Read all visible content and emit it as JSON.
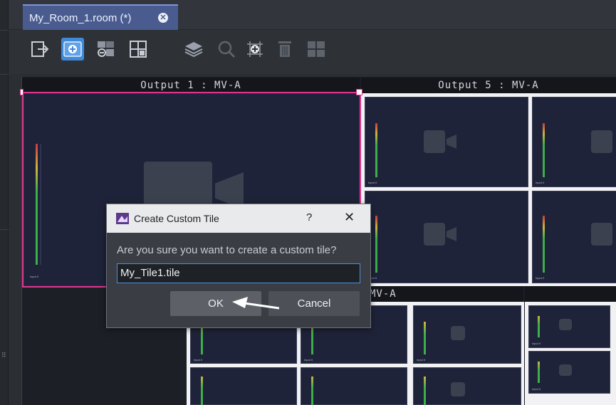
{
  "tab": {
    "title": "My_Room_1.room (*)",
    "close_icon": "close-circle-icon"
  },
  "toolbar": {
    "buttons": [
      {
        "name": "exit-icon",
        "state": "normal"
      },
      {
        "name": "add-tile-icon",
        "state": "active"
      },
      {
        "name": "link-icon",
        "state": "normal"
      },
      {
        "name": "grid-icon",
        "state": "normal"
      },
      {
        "name": "layers-icon",
        "state": "normal"
      },
      {
        "name": "zoom-icon",
        "state": "disabled"
      },
      {
        "name": "custom-tile-icon",
        "state": "normal"
      },
      {
        "name": "trash-icon",
        "state": "disabled"
      },
      {
        "name": "layout-icon",
        "state": "disabled"
      }
    ]
  },
  "outputs": {
    "output1": "Output 1 : MV-A",
    "output5": "Output 5 : MV-A",
    "output_partial": "MV-A"
  },
  "tile_label": "Input 0",
  "dialog": {
    "title": "Create Custom Tile",
    "help": "?",
    "close": "✕",
    "question": "Are you sure you want to create a custom tile?",
    "input_value": "My_Tile1.tile",
    "ok_label": "OK",
    "cancel_label": "Cancel"
  },
  "colors": {
    "accent": "#4a5c8f",
    "active_tool": "#3f8ad8",
    "selection": "#e0338d",
    "input_focus": "#4b8fe0"
  }
}
